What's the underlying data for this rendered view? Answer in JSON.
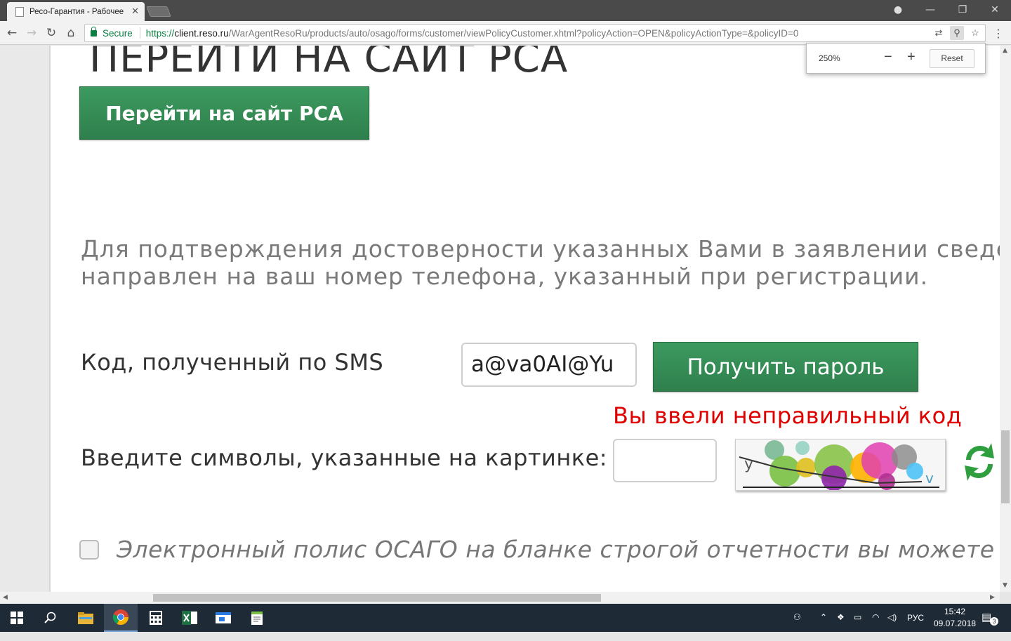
{
  "browser": {
    "tab_title": "Ресо-Гарантия - Рабочее",
    "secure_label": "Secure",
    "url_scheme": "https://",
    "url_host": "client.reso.ru",
    "url_path": "/WarAgentResoRu/products/auto/osago/forms/customer/viewPolicyCustomer.xhtml?policyAction=OPEN&policyActionType=&policyID=0",
    "zoom_level": "250%",
    "zoom_reset": "Reset"
  },
  "page": {
    "heading": "ПЕРЕЙТИ НА САЙТ РСА",
    "rsa_button": "Перейти на сайт РСА",
    "info_line1": "Для подтверждения достоверности указанных Вами в заявлении сведе",
    "info_line2": "направлен на ваш номер телефона, указанный при регистрации.",
    "sms_label": "Код, полученный по SMS",
    "sms_value": "a@va0AI@Yu",
    "get_password_button": "Получить пароль",
    "error_text": "Вы ввели неправильный код",
    "captcha_label": "Введите символы, указанные на картинке:",
    "captcha_value": "",
    "epolicy_text": "Электронный полис ОСАГО на бланке строгой отчетности вы можете полу"
  },
  "taskbar": {
    "language": "РУС",
    "time": "15:42",
    "date": "09.07.2018",
    "notifications": "3"
  },
  "colors": {
    "button_green": "#2f7f4c",
    "error_red": "#e00000",
    "secure_green": "#0b8043"
  }
}
